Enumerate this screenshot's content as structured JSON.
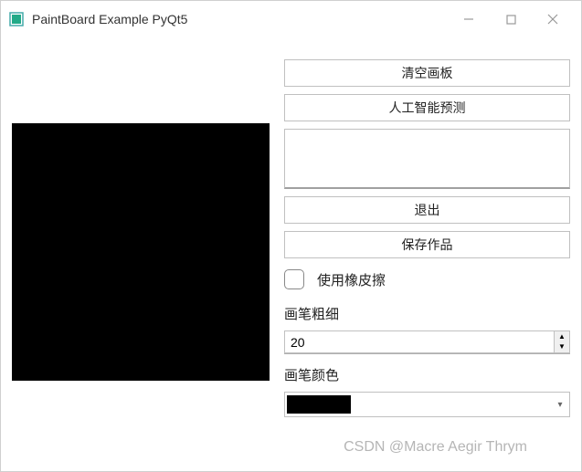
{
  "window": {
    "title": "PaintBoard Example PyQt5"
  },
  "buttons": {
    "clear": "清空画板",
    "predict": "人工智能预测",
    "exit": "退出",
    "save": "保存作品"
  },
  "checkbox": {
    "eraser_label": "使用橡皮擦",
    "checked": false
  },
  "pen_thickness": {
    "label": "画笔粗细",
    "value": "20"
  },
  "pen_color": {
    "label": "画笔颜色",
    "value": "#000000"
  },
  "result_text": "",
  "watermark": "CSDN @Macre Aegir Thrym"
}
